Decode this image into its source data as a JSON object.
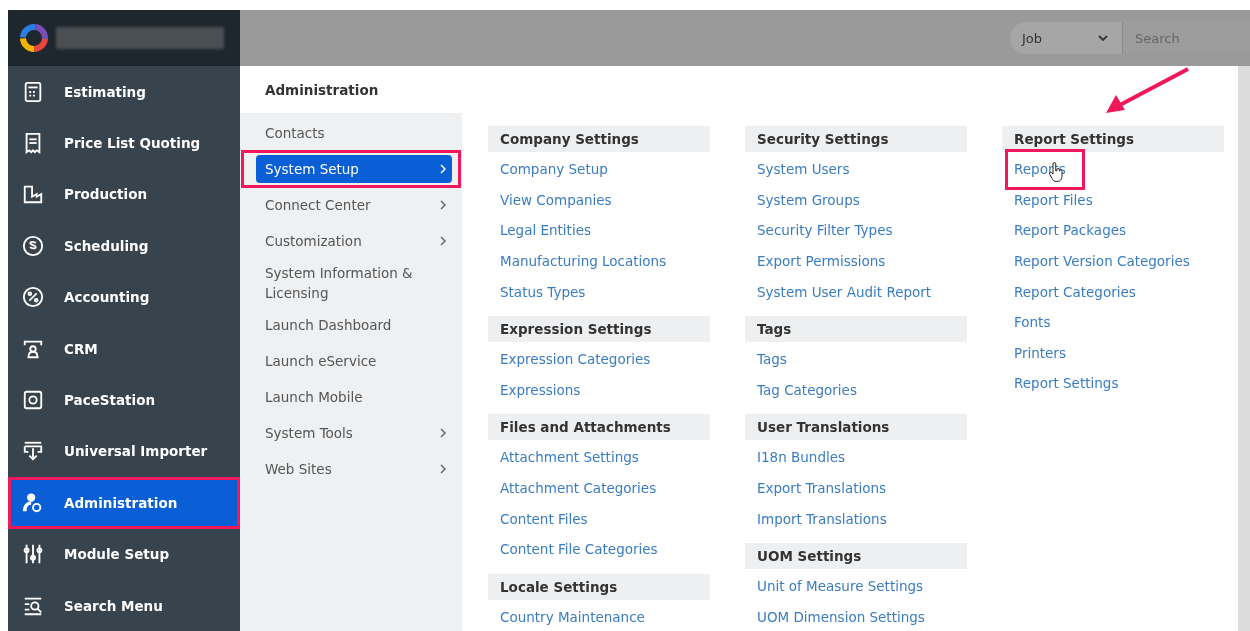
{
  "topbar": {
    "search_scope": "Job",
    "search": {
      "placeholder": "Search"
    }
  },
  "sidebar": {
    "items": [
      {
        "label": "Estimating",
        "selected": false,
        "annotated": false
      },
      {
        "label": "Price List Quoting",
        "selected": false,
        "annotated": false
      },
      {
        "label": "Production",
        "selected": false,
        "annotated": false
      },
      {
        "label": "Scheduling",
        "selected": false,
        "annotated": false
      },
      {
        "label": "Accounting",
        "selected": false,
        "annotated": false
      },
      {
        "label": "CRM",
        "selected": false,
        "annotated": false
      },
      {
        "label": "PaceStation",
        "selected": false,
        "annotated": false
      },
      {
        "label": "Universal Importer",
        "selected": false,
        "annotated": false
      },
      {
        "label": "Administration",
        "selected": true,
        "annotated": true
      },
      {
        "label": "Module Setup",
        "selected": false,
        "annotated": false
      },
      {
        "label": "Search Menu",
        "selected": false,
        "annotated": false
      }
    ]
  },
  "submenu": {
    "title": "Administration",
    "items": [
      {
        "label": "Contacts",
        "has_children": false,
        "selected": false,
        "annotated": false
      },
      {
        "label": "System Setup",
        "has_children": true,
        "selected": true,
        "annotated": true
      },
      {
        "label": "Connect Center",
        "has_children": true,
        "selected": false,
        "annotated": false
      },
      {
        "label": "Customization",
        "has_children": true,
        "selected": false,
        "annotated": false
      },
      {
        "label": "System Information & Licensing",
        "has_children": false,
        "selected": false,
        "annotated": false
      },
      {
        "label": "Launch Dashboard",
        "has_children": false,
        "selected": false,
        "annotated": false
      },
      {
        "label": "Launch eService",
        "has_children": false,
        "selected": false,
        "annotated": false
      },
      {
        "label": "Launch Mobile",
        "has_children": false,
        "selected": false,
        "annotated": false
      },
      {
        "label": "System Tools",
        "has_children": true,
        "selected": false,
        "annotated": false
      },
      {
        "label": "Web Sites",
        "has_children": true,
        "selected": false,
        "annotated": false
      }
    ]
  },
  "columns": [
    {
      "sections": [
        {
          "heading": "Company Settings",
          "links": [
            {
              "label": "Company Setup",
              "annotated": false
            },
            {
              "label": "View Companies",
              "annotated": false
            },
            {
              "label": "Legal Entities",
              "annotated": false
            },
            {
              "label": "Manufacturing Locations",
              "annotated": false
            },
            {
              "label": "Status Types",
              "annotated": false
            }
          ]
        },
        {
          "heading": "Expression Settings",
          "links": [
            {
              "label": "Expression Categories",
              "annotated": false
            },
            {
              "label": "Expressions",
              "annotated": false
            }
          ]
        },
        {
          "heading": "Files and Attachments",
          "links": [
            {
              "label": "Attachment Settings",
              "annotated": false
            },
            {
              "label": "Attachment Categories",
              "annotated": false
            },
            {
              "label": "Content Files",
              "annotated": false
            },
            {
              "label": "Content File Categories",
              "annotated": false
            }
          ]
        },
        {
          "heading": "Locale Settings",
          "links": [
            {
              "label": "Country Maintenance",
              "annotated": false
            }
          ]
        }
      ]
    },
    {
      "sections": [
        {
          "heading": "Security Settings",
          "links": [
            {
              "label": "System Users",
              "annotated": false
            },
            {
              "label": "System Groups",
              "annotated": false
            },
            {
              "label": "Security Filter Types",
              "annotated": false
            },
            {
              "label": "Export Permissions",
              "annotated": false
            },
            {
              "label": "System User Audit Report",
              "annotated": false
            }
          ]
        },
        {
          "heading": "Tags",
          "links": [
            {
              "label": "Tags",
              "annotated": false
            },
            {
              "label": "Tag Categories",
              "annotated": false
            }
          ]
        },
        {
          "heading": "User Translations",
          "links": [
            {
              "label": "I18n Bundles",
              "annotated": false
            },
            {
              "label": "Export Translations",
              "annotated": false
            },
            {
              "label": "Import Translations",
              "annotated": false
            }
          ]
        },
        {
          "heading": "UOM Settings",
          "links": [
            {
              "label": "Unit of Measure Settings",
              "annotated": false
            },
            {
              "label": "UOM Dimension Settings",
              "annotated": false
            }
          ]
        }
      ]
    },
    {
      "sections": [
        {
          "heading": "Report Settings",
          "links": [
            {
              "label": "Reports",
              "annotated": true
            },
            {
              "label": "Report Files",
              "annotated": false
            },
            {
              "label": "Report Packages",
              "annotated": false
            },
            {
              "label": "Report Version Categories",
              "annotated": false
            },
            {
              "label": "Report Categories",
              "annotated": false
            },
            {
              "label": "Fonts",
              "annotated": false
            },
            {
              "label": "Printers",
              "annotated": false
            },
            {
              "label": "Report Settings",
              "annotated": false
            }
          ]
        }
      ]
    }
  ]
}
